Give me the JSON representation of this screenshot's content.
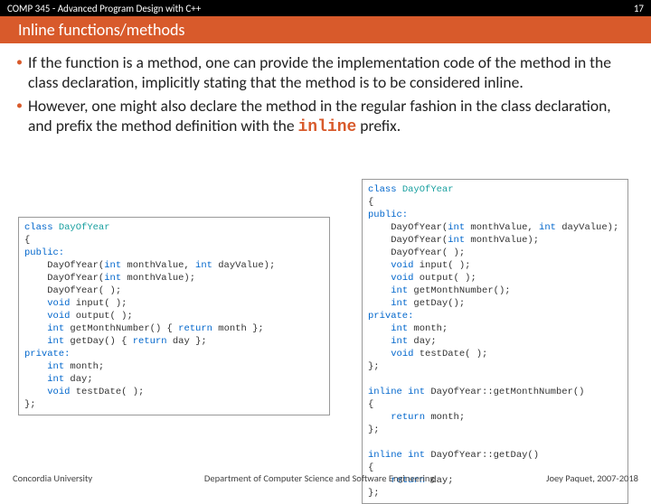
{
  "header": {
    "course": "COMP 345 - Advanced Program Design with C++",
    "slide_no": "17",
    "title": "Inline functions/methods"
  },
  "bullets": [
    "If the function is a method, one can provide the implementation code of the method in the class declaration, implicitly stating that the method is to be considered inline.",
    "However, one might also declare the method in the regular fashion in the class declaration, and prefix the method definition with the "
  ],
  "inline_kw": "inline",
  "inline_suffix": " prefix.",
  "code_left": {
    "l1": "class",
    "l1b": " DayOfYear",
    "l2": "{",
    "l3": "public:",
    "l4a": "    DayOfYear(",
    "l4b": "int",
    "l4c": " monthValue, ",
    "l4d": "int",
    "l4e": " dayValue);",
    "l5a": "    DayOfYear(",
    "l5b": "int",
    "l5c": " monthValue);",
    "l6": "    DayOfYear( );",
    "l7a": "    ",
    "l7b": "void",
    "l7c": " input( );",
    "l8a": "    ",
    "l8b": "void",
    "l8c": " output( );",
    "l9a": "    ",
    "l9b": "int",
    "l9c": " getMonthNumber() { ",
    "l9d": "return",
    "l9e": " month };",
    "l10a": "    ",
    "l10b": "int",
    "l10c": " getDay() { ",
    "l10d": "return",
    "l10e": " day };",
    "l11": "private:",
    "l12a": "    ",
    "l12b": "int",
    "l12c": " month;",
    "l13a": "    ",
    "l13b": "int",
    "l13c": " day;",
    "l14a": "    ",
    "l14b": "void",
    "l14c": " testDate( );",
    "l15": "};"
  },
  "code_right": {
    "r1": "class",
    "r1b": " DayOfYear",
    "r2": "{",
    "r3": "public:",
    "r4a": "    DayOfYear(",
    "r4b": "int",
    "r4c": " monthValue, ",
    "r4d": "int",
    "r4e": " dayValue);",
    "r5a": "    DayOfYear(",
    "r5b": "int",
    "r5c": " monthValue);",
    "r6": "    DayOfYear( );",
    "r7a": "    ",
    "r7b": "void",
    "r7c": " input( );",
    "r8a": "    ",
    "r8b": "void",
    "r8c": " output( );",
    "r9a": "    ",
    "r9b": "int",
    "r9c": " getMonthNumber();",
    "r10a": "    ",
    "r10b": "int",
    "r10c": " getDay();",
    "r11": "private:",
    "r12a": "    ",
    "r12b": "int",
    "r12c": " month;",
    "r13a": "    ",
    "r13b": "int",
    "r13c": " day;",
    "r14a": "    ",
    "r14b": "void",
    "r14c": " testDate( );",
    "r15": "};",
    "blank": " ",
    "r16a": "inline int",
    "r16b": " DayOfYear::getMonthNumber()",
    "r17": "{",
    "r18a": "    ",
    "r18b": "return",
    "r18c": " month;",
    "r19": "};",
    "r20a": "inline int",
    "r20b": " DayOfYear::getDay()",
    "r21": "{",
    "r22a": "    ",
    "r22b": "return",
    "r22c": " day;",
    "r23": "};"
  },
  "footer": {
    "left": "Concordia University",
    "center": "Department of Computer Science and Software Engineering",
    "right": "Joey Paquet, 2007-2018"
  }
}
